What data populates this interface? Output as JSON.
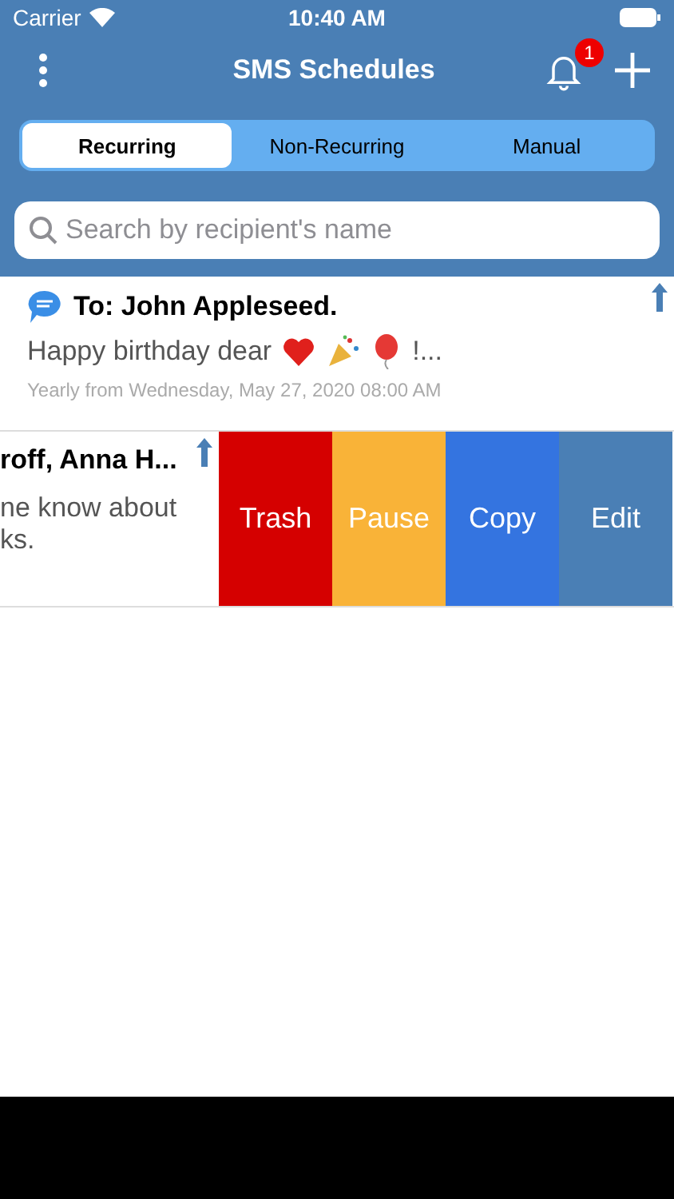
{
  "status_bar": {
    "carrier": "Carrier",
    "time": "10:40 AM"
  },
  "nav": {
    "title": "SMS Schedules",
    "badge": "1"
  },
  "tabs": [
    {
      "label": "Recurring",
      "selected": true
    },
    {
      "label": "Non-Recurring",
      "selected": false
    },
    {
      "label": "Manual",
      "selected": false
    }
  ],
  "search": {
    "placeholder": "Search by recipient's name"
  },
  "schedules": [
    {
      "recipient": "To: John Appleseed.",
      "message": "Happy birthday dear",
      "message_end": "!...",
      "schedule": "Yearly from Wednesday, May 27, 2020 08:00 AM"
    }
  ],
  "swiped_row": {
    "recipient": "roff, Anna H...",
    "message_lines": [
      "ne know about",
      "ks."
    ],
    "actions": [
      {
        "label": "Trash",
        "color": "#d50000"
      },
      {
        "label": "Pause",
        "color": "#f9b338"
      },
      {
        "label": "Copy",
        "color": "#3474e0"
      },
      {
        "label": "Edit",
        "color": "#4a7fb5"
      }
    ]
  }
}
